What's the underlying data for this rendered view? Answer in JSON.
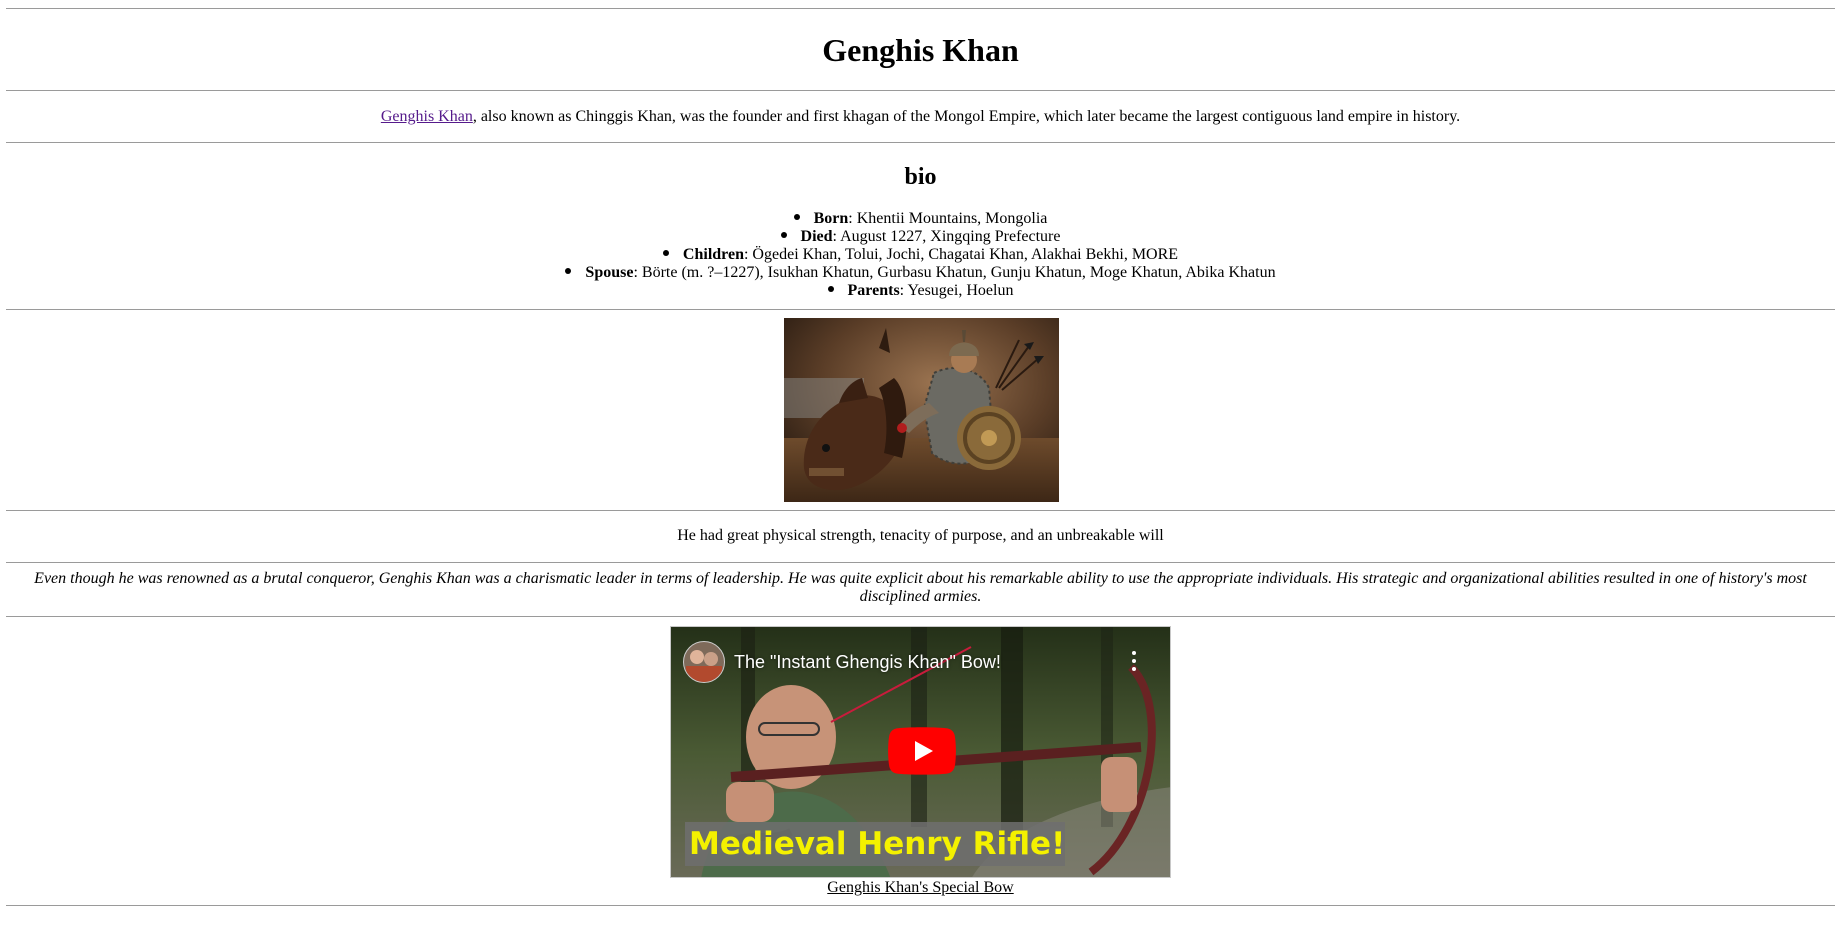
{
  "page": {
    "title": "Genghis Khan"
  },
  "intro": {
    "link_text": "Genghis Khan",
    "text": ", also known as Chinggis Khan, was the founder and first khagan of the Mongol Empire, which later became the largest contiguous land empire in history."
  },
  "bio": {
    "heading": "bio",
    "items": [
      {
        "label": "Born",
        "value": ": Khentii Mountains, Mongolia"
      },
      {
        "label": "Died",
        "value": ": August 1227, Xingqing Prefecture"
      },
      {
        "label": "Children",
        "value": ": Ögedei Khan, Tolui, Jochi, Chagatai Khan, Alakhai Bekhi, MORE"
      },
      {
        "label": "Spouse",
        "value": ": Börte (m. ?–1227), Isukhan Khatun, Gurbasu Khatun, Gunju Khatun, Moge Khatun, Abika Khatun"
      },
      {
        "label": "Parents",
        "value": ": Yesugei, Hoelun"
      }
    ]
  },
  "quote": {
    "text": "He had great physical strength, tenacity of purpose, and an unbreakable will"
  },
  "description": {
    "text": "Even though he was renowned as a brutal conqueror, Genghis Khan was a charismatic leader in terms of leadership. He was quite explicit about his remarkable ability to use the appropriate individuals. His strategic and organizational abilities resulted in one of history's most disciplined armies."
  },
  "video": {
    "title": "The \"Instant Ghengis Khan\" Bow!",
    "overlay_text": "Medieval Henry Rifle!",
    "caption": "Genghis Khan's Special Bow",
    "play_icon": "youtube-play-icon",
    "menu_icon": "more-vert-icon"
  },
  "colors": {
    "link": "#551a8b",
    "rule": "#9a9a9a",
    "youtube_red": "#ff0000",
    "overlay_yellow": "#f4f100"
  }
}
